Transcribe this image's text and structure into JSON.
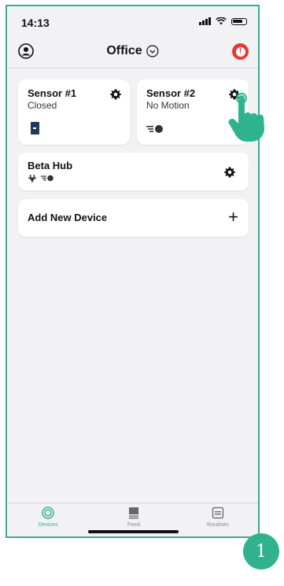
{
  "status_bar": {
    "time": "14:13"
  },
  "header": {
    "title": "Office"
  },
  "devices": [
    {
      "name": "Sensor #1",
      "state": "Closed"
    },
    {
      "name": "Sensor #2",
      "state": "No Motion"
    },
    {
      "name": "Beta Hub",
      "state": ""
    }
  ],
  "add_device": {
    "label": "Add New Device"
  },
  "tabs": [
    {
      "label": "Devices",
      "icon": "devices-icon",
      "active": true
    },
    {
      "label": "Feed",
      "icon": "feed-icon",
      "active": false
    },
    {
      "label": "Routines",
      "icon": "routines-icon",
      "active": false
    }
  ],
  "step_badge": "1",
  "colors": {
    "accent": "#2fb38f",
    "alert": "#e53935",
    "background": "#f2f2f4",
    "door": "#1f3b5a"
  }
}
